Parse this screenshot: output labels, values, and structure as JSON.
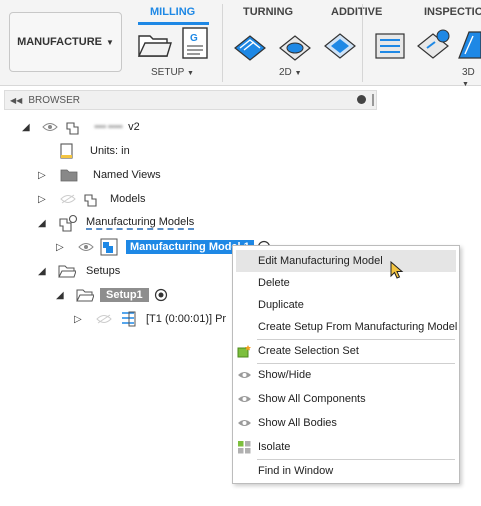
{
  "toolbar": {
    "workspace": "MANUFACTURE",
    "tabs": [
      {
        "label": "MILLING",
        "active": true
      },
      {
        "label": "TURNING",
        "active": false
      },
      {
        "label": "ADDITIVE",
        "active": false
      },
      {
        "label": "INSPECTION",
        "active": false
      }
    ],
    "groups": [
      "SETUP",
      "2D",
      "3D"
    ],
    "accent_color": "#1e88e5"
  },
  "browser": {
    "title": "BROWSER",
    "tree": {
      "root_name": "▪▪▪▪ ▪▪▪▪▪",
      "root_version": "v2",
      "units": "Units: in",
      "named_views": "Named Views",
      "models": "Models",
      "manufacturing_models": "Manufacturing Models",
      "manufacturing_model_1": "Manufacturing Model 1",
      "setups": "Setups",
      "setup1": "Setup1",
      "operation": "[T1 (0:00:01)] Pr"
    }
  },
  "context_menu": {
    "items": [
      {
        "label": "Edit Manufacturing Model",
        "icon": "",
        "highlighted": true
      },
      {
        "label": "Delete",
        "icon": ""
      },
      {
        "label": "Duplicate",
        "icon": ""
      },
      {
        "label": "Create Setup From Manufacturing Model",
        "icon": ""
      },
      {
        "label": "Create Selection Set",
        "icon": "selection-set-icon"
      },
      {
        "label": "Show/Hide",
        "icon": "eye-icon"
      },
      {
        "label": "Show All Components",
        "icon": "eye-icon"
      },
      {
        "label": "Show All Bodies",
        "icon": "eye-icon"
      },
      {
        "label": "Isolate",
        "icon": "isolate-icon"
      },
      {
        "label": "Find in Window",
        "icon": ""
      }
    ]
  }
}
